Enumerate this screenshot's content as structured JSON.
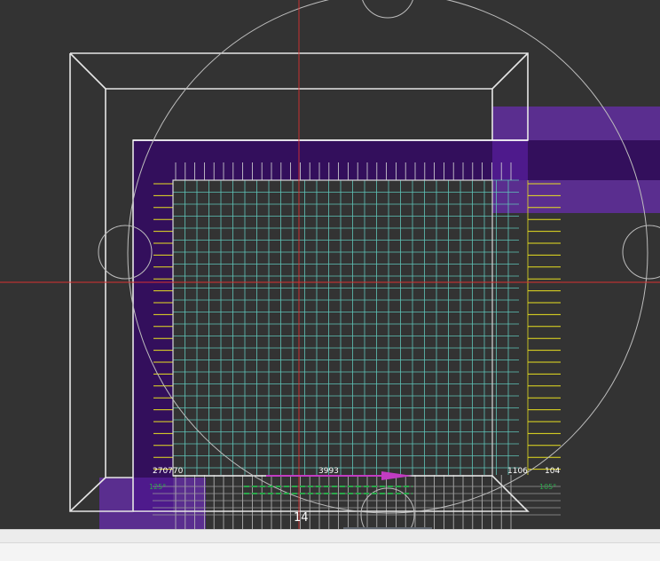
{
  "canvas": {
    "background": "#333333",
    "crosshair_color": "#d93030",
    "outline_color": "#e6e6e6",
    "grid_color": "#5fc4b8",
    "pad_color": "#e8e020",
    "fill_dark": "#330f5c",
    "fill_light": "#5a2e8f",
    "arrow_color": "#c23cc2",
    "green_text_color": "#2aa84a"
  },
  "dimensions": {
    "left_label": "270770",
    "center_label": "3993",
    "right_label": "1106",
    "far_right_label": "104",
    "green_left": "125°",
    "green_right": "105°"
  },
  "cursor": {
    "readout": "14"
  },
  "status": {
    "top_text": "",
    "bottom_text": ""
  }
}
